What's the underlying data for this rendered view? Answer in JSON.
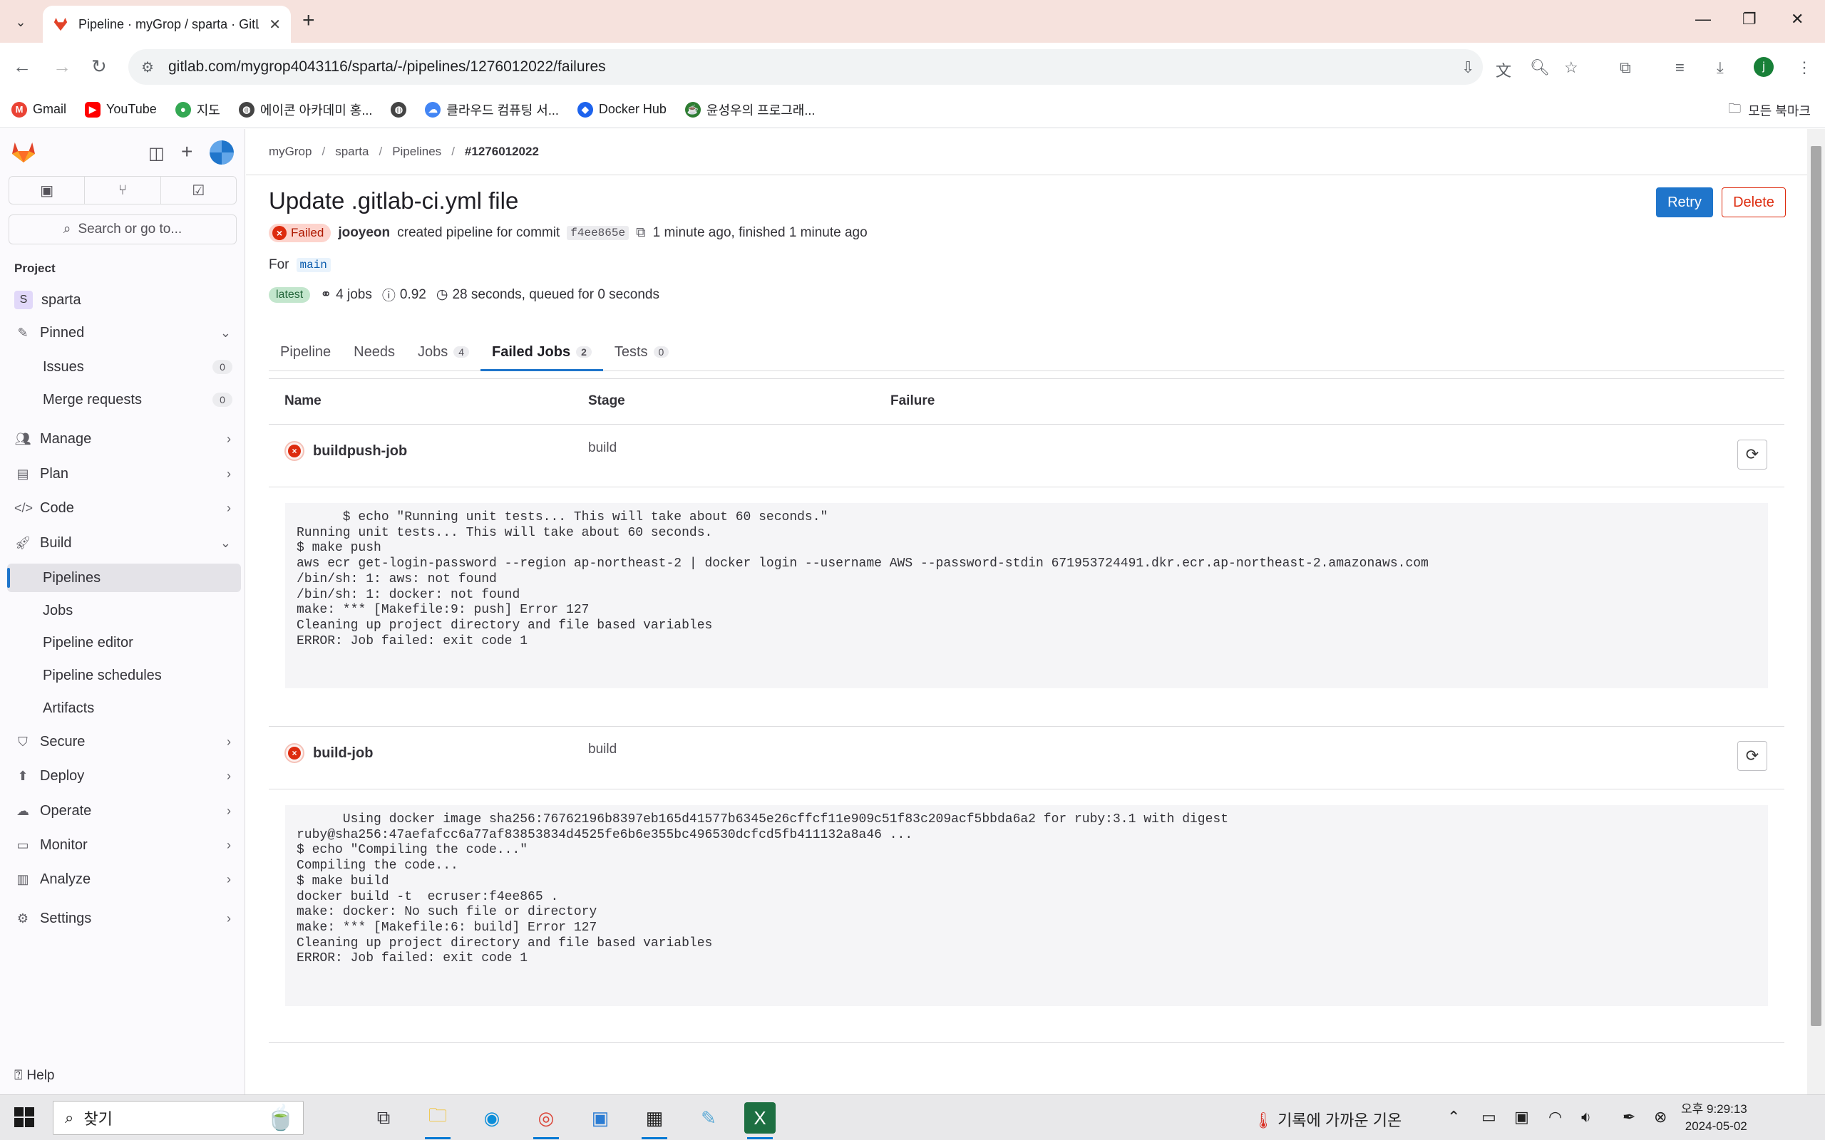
{
  "browser": {
    "tab_title": "Pipeline · myGrop / sparta · GitL",
    "url": "gitlab.com/mygrop4043116/sparta/-/pipelines/1276012022/failures",
    "bookmarks": [
      "Gmail",
      "YouTube",
      "지도",
      "에이콘 아카데미 홍...",
      "",
      "클라우드 컴퓨팅 서...",
      "Docker Hub",
      "윤성우의 프로그래..."
    ],
    "bookmark_folder": "모든 북마크"
  },
  "sidebar": {
    "search_label": "Search or go to...",
    "section_label": "Project",
    "project_name": "sparta",
    "project_initial": "S",
    "pinned_label": "Pinned",
    "pinned_items": [
      {
        "label": "Issues",
        "count": "0"
      },
      {
        "label": "Merge requests",
        "count": "0"
      }
    ],
    "groups": [
      "Manage",
      "Plan",
      "Code",
      "Build"
    ],
    "build_items": [
      "Pipelines",
      "Jobs",
      "Pipeline editor",
      "Pipeline schedules",
      "Artifacts"
    ],
    "groups2": [
      "Secure",
      "Deploy",
      "Operate",
      "Monitor",
      "Analyze"
    ],
    "settings_label": "Settings",
    "help_label": "Help"
  },
  "breadcrumb": [
    "myGrop",
    "sparta",
    "Pipelines",
    "#1276012022"
  ],
  "pipeline": {
    "title": "Update .gitlab-ci.yml file",
    "status": "Failed",
    "author": "jooyeon",
    "created_text": "created pipeline for commit",
    "commit_sha": "f4ee865e",
    "timing": "1 minute ago, finished 1 minute ago",
    "for_label": "For",
    "ref": "main",
    "latest_label": "latest",
    "jobs_count": "4 jobs",
    "score": "0.92",
    "duration": "28 seconds, queued for 0 seconds",
    "retry_label": "Retry",
    "delete_label": "Delete"
  },
  "tabs": [
    {
      "label": "Pipeline",
      "count": ""
    },
    {
      "label": "Needs",
      "count": ""
    },
    {
      "label": "Jobs",
      "count": "4"
    },
    {
      "label": "Failed Jobs",
      "count": "2"
    },
    {
      "label": "Tests",
      "count": "0"
    }
  ],
  "table": {
    "headers": [
      "Name",
      "Stage",
      "Failure"
    ],
    "jobs": [
      {
        "name": "buildpush-job",
        "stage": "build",
        "log": "      $ echo \"Running unit tests... This will take about 60 seconds.\"\nRunning unit tests... This will take about 60 seconds.\n$ make push\naws ecr get-login-password --region ap-northeast-2 | docker login --username AWS --password-stdin 671953724491.dkr.ecr.ap-northeast-2.amazonaws.com\n/bin/sh: 1: aws: not found\n/bin/sh: 1: docker: not found\nmake: *** [Makefile:9: push] Error 127\nCleaning up project directory and file based variables\nERROR: Job failed: exit code 1"
      },
      {
        "name": "build-job",
        "stage": "build",
        "log": "      Using docker image sha256:76762196b8397eb165d41577b6345e26cffcf11e909c51f83c209acf5bbda6a2 for ruby:3.1 with digest\nruby@sha256:47aefafcc6a77af83853834d4525fe6b6e355bc496530dcfcd5fb411132a8a46 ...\n$ echo \"Compiling the code...\"\nCompiling the code...\n$ make build\ndocker build -t  ecruser:f4ee865 .\nmake: docker: No such file or directory\nmake: *** [Makefile:6: build] Error 127\nCleaning up project directory and file based variables\nERROR: Job failed: exit code 1"
      }
    ]
  },
  "taskbar": {
    "search_placeholder": "찾기",
    "weather": "기록에 가까운 기온",
    "time": "오후 9:29:13",
    "date": "2024-05-02"
  }
}
